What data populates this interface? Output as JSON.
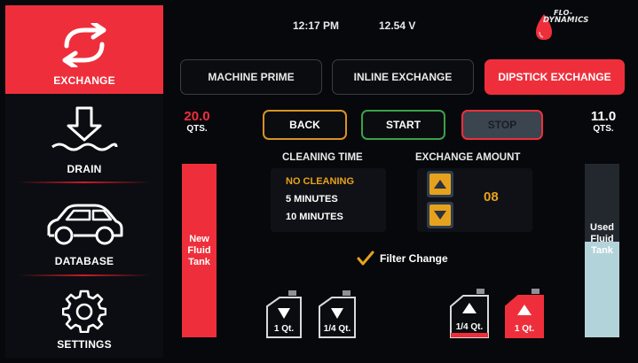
{
  "sidebar": {
    "items": [
      {
        "label": "EXCHANGE",
        "icon": "refresh-arrows-icon",
        "active": true
      },
      {
        "label": "DRAIN",
        "icon": "drain-arrow-icon",
        "active": false
      },
      {
        "label": "DATABASE",
        "icon": "car-icon",
        "active": false
      },
      {
        "label": "SETTINGS",
        "icon": "gear-icon",
        "active": false
      }
    ]
  },
  "status": {
    "time": "12:17 PM",
    "voltage": "12.54 V"
  },
  "brand": {
    "line1": "FLO-",
    "line2": "DYNAMICS",
    "icon": "oil-drop-logo"
  },
  "modes": [
    {
      "label": "MACHINE PRIME",
      "active": false
    },
    {
      "label": "INLINE EXCHANGE",
      "active": false
    },
    {
      "label": "DIPSTICK EXCHANGE",
      "active": true
    }
  ],
  "new_tank": {
    "quantity": "20.0",
    "unit": "QTS.",
    "label_lines": [
      "New",
      "Fluid",
      "Tank"
    ],
    "fill_level": 1.0
  },
  "used_tank": {
    "quantity": "11.0",
    "unit": "QTS.",
    "label_lines": [
      "Used",
      "Fluid",
      "Tank"
    ],
    "fill_level": 0.55
  },
  "controls": {
    "back": "BACK",
    "start": "START",
    "stop": "STOP"
  },
  "cleaning": {
    "heading": "CLEANING TIME",
    "options": [
      "NO CLEANING",
      "5 MINUTES",
      "10 MINUTES"
    ],
    "selected": "NO CLEANING"
  },
  "exchange": {
    "heading": "EXCHANGE AMOUNT",
    "value": "08"
  },
  "filter_change": {
    "label": "Filter Change",
    "checked": true
  },
  "bottles": {
    "down_1": "1 Qt.",
    "down_quarter": "1/4 Qt.",
    "up_quarter": "1/4 Qt.",
    "up_1": "1 Qt."
  },
  "colors": {
    "accent": "#ee2f3b",
    "yellow": "#e7a21d",
    "green": "#3aa14a",
    "orange": "#d89223",
    "used_tank": "#b3d3da"
  }
}
